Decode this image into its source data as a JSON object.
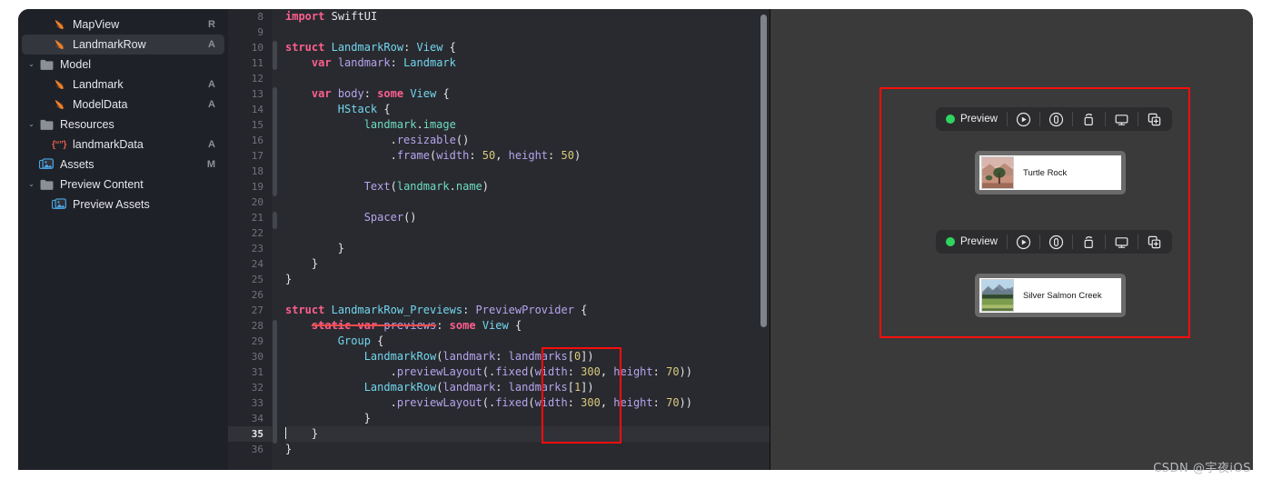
{
  "sidebar": {
    "items": [
      {
        "label": "MapView",
        "icon": "swift-file-icon",
        "status": "R",
        "indent": 1,
        "disclosure": "",
        "selected": false
      },
      {
        "label": "LandmarkRow",
        "icon": "swift-file-icon",
        "status": "A",
        "indent": 1,
        "disclosure": "",
        "selected": true
      },
      {
        "label": "Model",
        "icon": "folder-icon",
        "status": "",
        "indent": 0,
        "disclosure": "v",
        "selected": false
      },
      {
        "label": "Landmark",
        "icon": "swift-file-icon",
        "status": "A",
        "indent": 1,
        "disclosure": "",
        "selected": false
      },
      {
        "label": "ModelData",
        "icon": "swift-file-icon",
        "status": "A",
        "indent": 1,
        "disclosure": "",
        "selected": false
      },
      {
        "label": "Resources",
        "icon": "folder-icon",
        "status": "",
        "indent": 0,
        "disclosure": "v",
        "selected": false
      },
      {
        "label": "landmarkData",
        "icon": "json-file-icon",
        "status": "A",
        "indent": 1,
        "disclosure": "",
        "selected": false
      },
      {
        "label": "Assets",
        "icon": "assets-icon",
        "status": "M",
        "indent": 0,
        "disclosure": "",
        "selected": false
      },
      {
        "label": "Preview Content",
        "icon": "folder-icon",
        "status": "",
        "indent": 0,
        "disclosure": "v",
        "selected": false
      },
      {
        "label": "Preview Assets",
        "icon": "assets-icon",
        "status": "",
        "indent": 1,
        "disclosure": "",
        "selected": false
      }
    ]
  },
  "editor": {
    "first_line_number": 8,
    "active_line_number": 35,
    "lines": [
      {
        "n": 8,
        "html": "<span class=\"kw\">import</span> <span class=\"plain\">SwiftUI</span>"
      },
      {
        "n": 9,
        "html": ""
      },
      {
        "n": 10,
        "html": "<span class=\"kw\">struct</span> <span class=\"typ\">LandmarkRow</span><span class=\"plain\">: </span><span class=\"typ\">View</span> <span class=\"plain\">{</span>"
      },
      {
        "n": 11,
        "html": "    <span class=\"kw\">var</span> <span class=\"id\">landmark</span><span class=\"plain\">: </span><span class=\"typ\">Landmark</span>"
      },
      {
        "n": 12,
        "html": ""
      },
      {
        "n": 13,
        "html": "    <span class=\"kw\">var</span> <span class=\"id\">body</span><span class=\"plain\">: </span><span class=\"kw\">some</span> <span class=\"typ\">View</span> <span class=\"plain\">{</span>"
      },
      {
        "n": 14,
        "html": "        <span class=\"typ\">HStack</span> <span class=\"plain\">{</span>"
      },
      {
        "n": 15,
        "html": "            <span class=\"prop\">landmark</span><span class=\"plain\">.</span><span class=\"prop\">image</span>"
      },
      {
        "n": 16,
        "html": "                <span class=\"plain\">.</span><span class=\"id\">resizable</span><span class=\"plain\">()</span>"
      },
      {
        "n": 17,
        "html": "                <span class=\"plain\">.</span><span class=\"id\">frame</span><span class=\"plain\">(</span><span class=\"id\">width</span><span class=\"plain\">: </span><span class=\"num\">50</span><span class=\"plain\">, </span><span class=\"id\">height</span><span class=\"plain\">: </span><span class=\"num\">50</span><span class=\"plain\">)</span>"
      },
      {
        "n": 18,
        "html": ""
      },
      {
        "n": 19,
        "html": "            <span class=\"id\">Text</span><span class=\"plain\">(</span><span class=\"prop\">landmark</span><span class=\"plain\">.</span><span class=\"prop\">name</span><span class=\"plain\">)</span>"
      },
      {
        "n": 20,
        "html": ""
      },
      {
        "n": 21,
        "html": "            <span class=\"id\">Spacer</span><span class=\"plain\">()</span>"
      },
      {
        "n": 22,
        "html": ""
      },
      {
        "n": 23,
        "html": "        <span class=\"plain\">}</span>"
      },
      {
        "n": 24,
        "html": "    <span class=\"plain\">}</span>"
      },
      {
        "n": 25,
        "html": "<span class=\"plain\">}</span>"
      },
      {
        "n": 26,
        "html": ""
      },
      {
        "n": 27,
        "html": "<span class=\"kw\">struct</span> <span class=\"typ\">LandmarkRow_Previews</span><span class=\"plain\">: </span><span class=\"id\">PreviewProvider</span> <span class=\"plain\">{</span>"
      },
      {
        "n": 28,
        "html": "    <span class=\"kw strike\">static</span><span class=\"strike\"> </span><span class=\"kw strike\">var</span><span class=\"strike\"> </span><span class=\"id strike\">previews</span><span class=\"plain\">: </span><span class=\"kw\">some</span> <span class=\"typ\">View</span> <span class=\"plain\">{</span>"
      },
      {
        "n": 29,
        "html": "        <span class=\"typ\">Group</span> <span class=\"plain\">{</span>"
      },
      {
        "n": 30,
        "html": "            <span class=\"typ\">LandmarkRow</span><span class=\"plain\">(</span><span class=\"id\">landmark</span><span class=\"plain\">: </span><span class=\"id\">landmarks</span><span class=\"plain\">[</span><span class=\"num\">0</span><span class=\"plain\">])</span>"
      },
      {
        "n": 31,
        "html": "                <span class=\"plain\">.</span><span class=\"id\">previewLayout</span><span class=\"plain\">(.</span><span class=\"id\">fixed</span><span class=\"plain\">(</span><span class=\"id\">width</span><span class=\"plain\">: </span><span class=\"num\">300</span><span class=\"plain\">, </span><span class=\"id\">height</span><span class=\"plain\">: </span><span class=\"num\">70</span><span class=\"plain\">))</span>"
      },
      {
        "n": 32,
        "html": "            <span class=\"typ\">LandmarkRow</span><span class=\"plain\">(</span><span class=\"id\">landmark</span><span class=\"plain\">: </span><span class=\"id\">landmarks</span><span class=\"plain\">[</span><span class=\"num\">1</span><span class=\"plain\">])</span>"
      },
      {
        "n": 33,
        "html": "                <span class=\"plain\">.</span><span class=\"id\">previewLayout</span><span class=\"plain\">(.</span><span class=\"id\">fixed</span><span class=\"plain\">(</span><span class=\"id\">width</span><span class=\"plain\">: </span><span class=\"num\">300</span><span class=\"plain\">, </span><span class=\"id\">height</span><span class=\"plain\">: </span><span class=\"num\">70</span><span class=\"plain\">))</span>"
      },
      {
        "n": 34,
        "html": "            <span class=\"plain\">}</span>"
      },
      {
        "n": 35,
        "html": "<span class=\"caret\"></span>    <span class=\"plain\">}</span>"
      },
      {
        "n": 36,
        "html": "<span class=\"plain\">}</span>"
      }
    ]
  },
  "preview_panel": {
    "groups": [
      {
        "toolbar": {
          "status_label": "Preview",
          "status_color": "#2fd45e",
          "buttons": [
            "play-circle-icon",
            "inspect-circle-icon",
            "rotate-3d-icon",
            "display-icon",
            "duplicate-add-icon"
          ]
        },
        "card": {
          "name": "Turtle Rock",
          "thumbnail": "turtle-rock-thumbnail"
        }
      },
      {
        "toolbar": {
          "status_label": "Preview",
          "status_color": "#2fd45e",
          "buttons": [
            "play-circle-icon",
            "inspect-circle-icon",
            "rotate-3d-icon",
            "display-icon",
            "duplicate-add-icon"
          ]
        },
        "card": {
          "name": "Silver Salmon Creek",
          "thumbnail": "silver-salmon-creek-thumbnail"
        }
      }
    ],
    "annotation_color": "#fd0d0d"
  },
  "watermark": {
    "text": "CSDN @宇夜iOS"
  }
}
